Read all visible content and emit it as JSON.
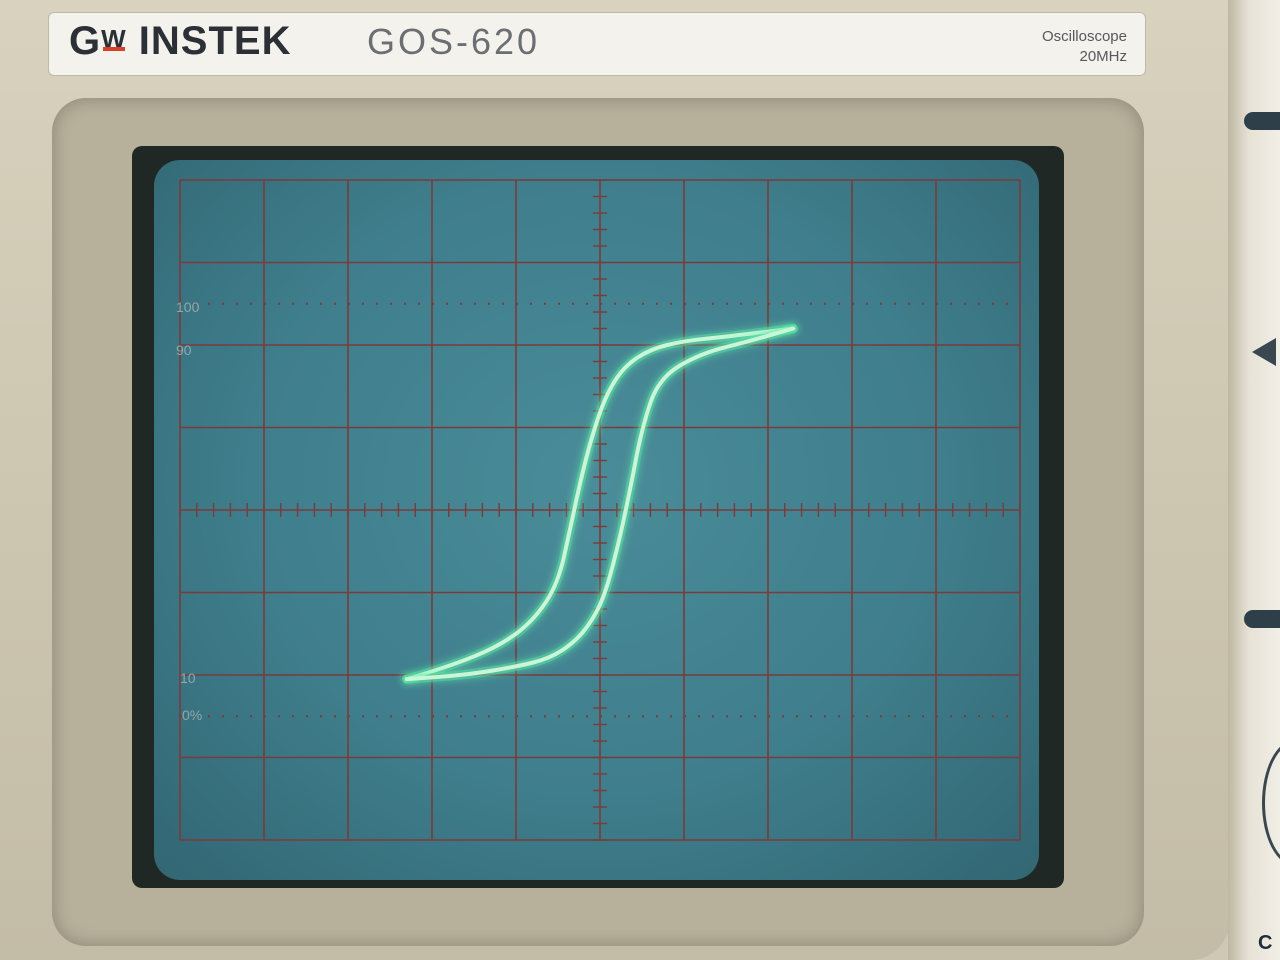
{
  "instrument": {
    "brand_prefix": "G",
    "brand_w": "W",
    "brand_name": "INSTEK",
    "model": "GOS-620",
    "type": "Oscilloscope",
    "bandwidth": "20MHz"
  },
  "graticule": {
    "label_100": "100",
    "label_90": "90",
    "label_10": "10",
    "label_0": "0%"
  },
  "colors": {
    "screen": "#3f7e8c",
    "grid": "#7a3b3a",
    "trace": "#c9f6d8",
    "trace_glow": "#5ef0a8",
    "brand_accent": "#d8402a"
  },
  "chart_data": {
    "type": "line",
    "title": "",
    "xlabel": "",
    "ylabel": "",
    "xlim": [
      -5,
      5
    ],
    "ylim": [
      -4,
      4
    ],
    "grid": true,
    "series": [
      {
        "x": [
          -2.3,
          -1.8,
          -1.2,
          -0.8,
          -0.5,
          -0.35,
          -0.2,
          -0.05,
          0.1,
          0.3,
          0.6,
          1.0,
          1.5,
          2.3
        ],
        "y": [
          -2.05,
          -1.9,
          -1.65,
          -1.35,
          -0.9,
          -0.2,
          0.5,
          1.05,
          1.45,
          1.75,
          1.95,
          2.05,
          2.1,
          2.2
        ]
      },
      {
        "x": [
          2.3,
          1.8,
          1.2,
          0.7,
          0.5,
          0.35,
          0.2,
          0.05,
          -0.1,
          -0.3,
          -0.6,
          -1.0,
          -1.6,
          -2.3
        ],
        "y": [
          2.2,
          2.05,
          1.9,
          1.6,
          1.0,
          0.2,
          -0.5,
          -1.05,
          -1.35,
          -1.6,
          -1.8,
          -1.9,
          -2.0,
          -2.05
        ]
      }
    ]
  }
}
